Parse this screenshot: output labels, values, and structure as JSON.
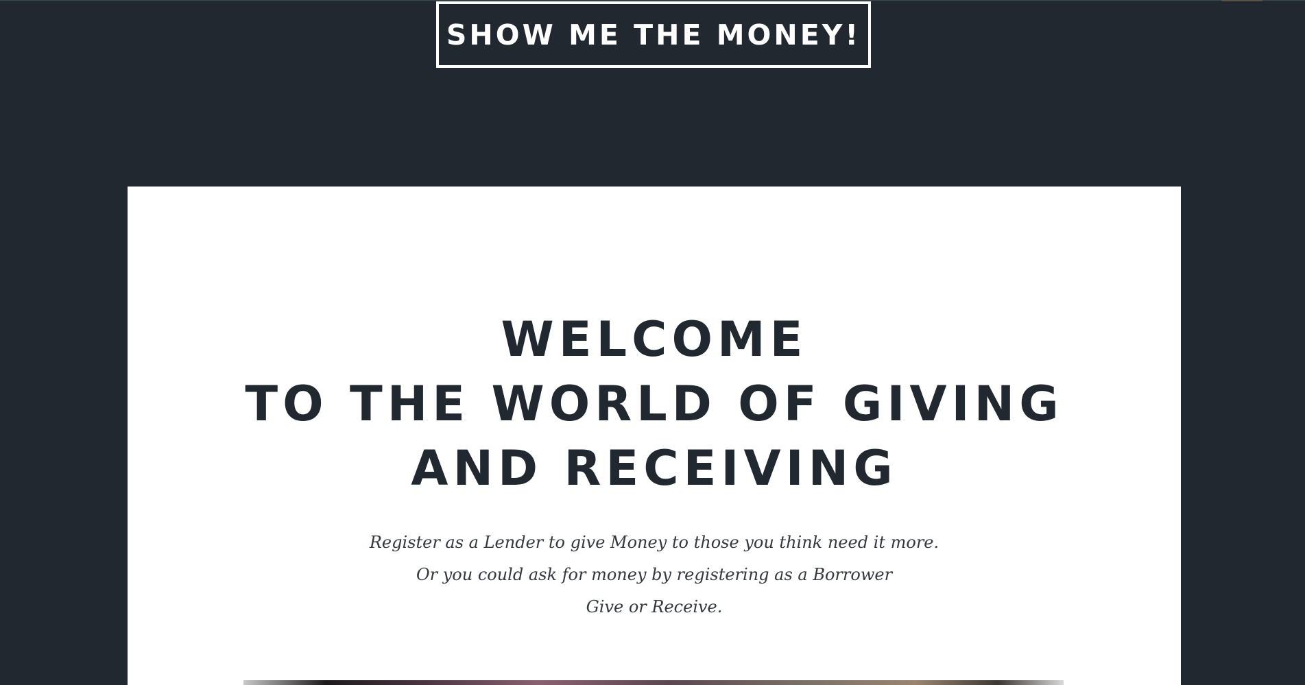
{
  "header": {
    "cta_label": "SHOW ME THE MONEY!"
  },
  "hero": {
    "heading_lines": [
      "WELCOME",
      "TO THE WORLD OF GIVING",
      "AND RECEIVING"
    ],
    "intro_lines": [
      "Register as a Lender to give Money to those you think need it more.",
      "Or you could ask for money by registering as a Borrower",
      "Give or Receive."
    ]
  },
  "colors": {
    "page_background": "#212830",
    "card_background": "#ffffff",
    "heading_text": "#212830",
    "body_text": "#33393f",
    "button_border": "#ffffff"
  }
}
